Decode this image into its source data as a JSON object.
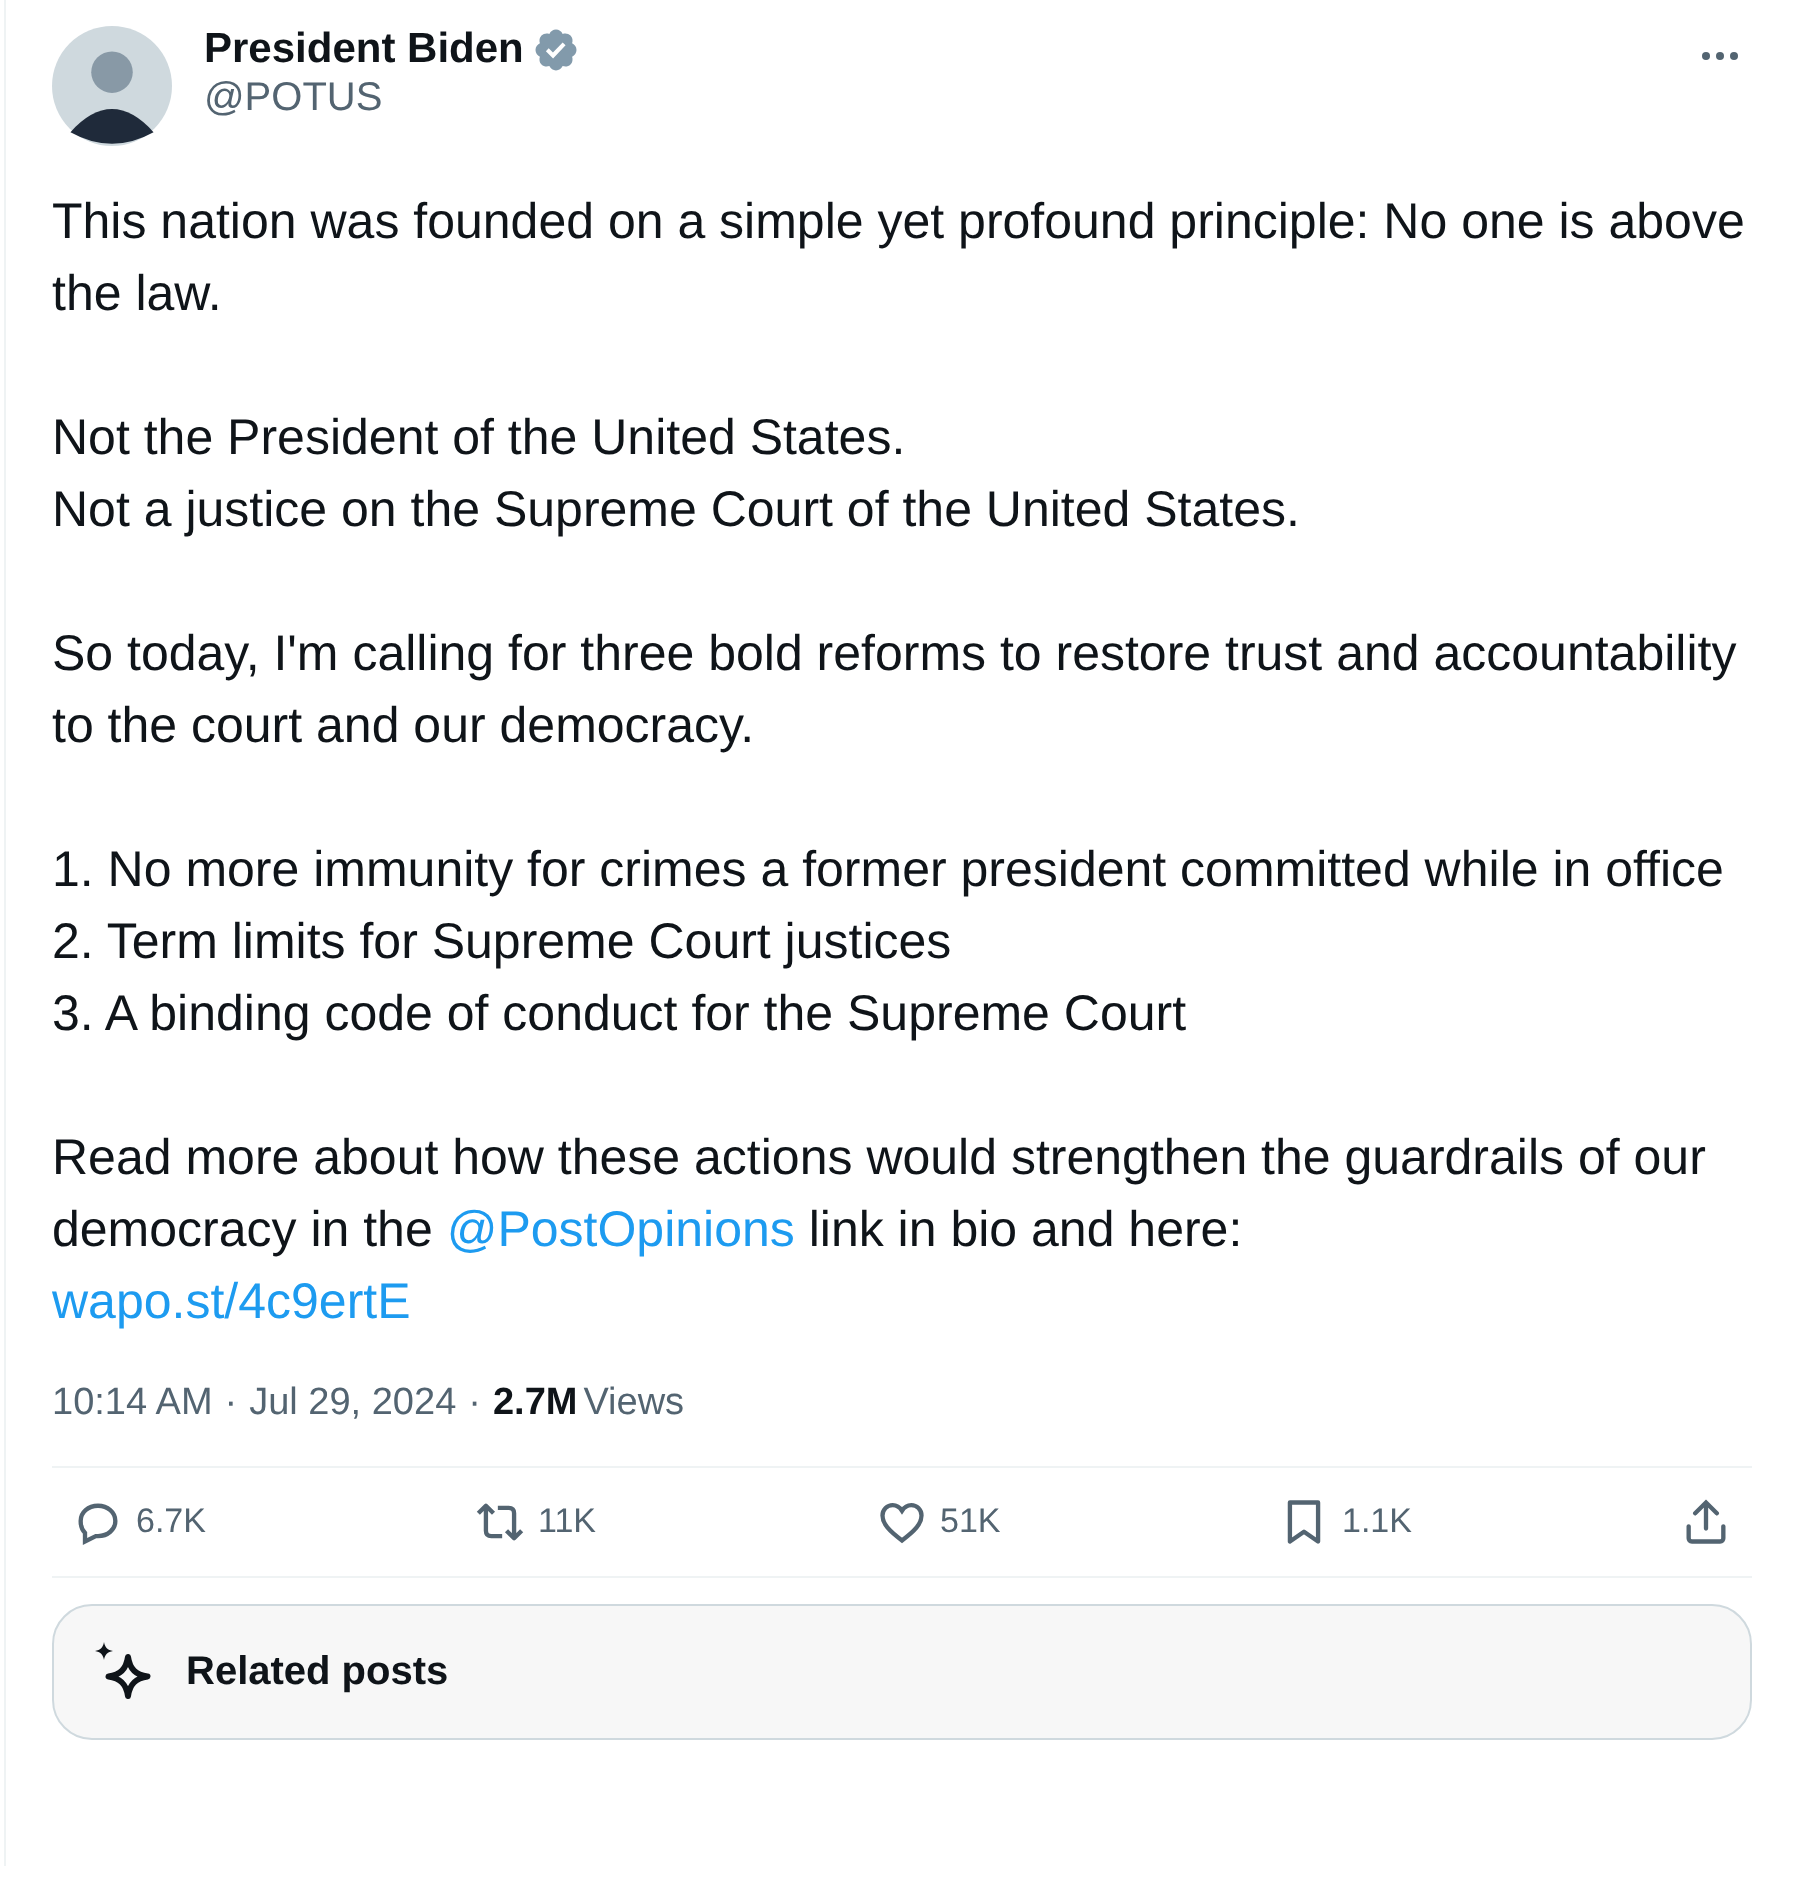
{
  "author": {
    "name": "President Biden",
    "verified": true,
    "handle": "@POTUS"
  },
  "paragraphs": [
    [
      {
        "text": "This nation was founded on a simple yet profound principle: No one is above the law."
      }
    ],
    [
      {
        "text": "Not the President of the United States.\nNot a justice on the Supreme Court of the United States."
      }
    ],
    [
      {
        "text": "So today, I'm calling for three bold reforms to restore trust and accountability to the court and our democracy."
      }
    ],
    [
      {
        "text": "1. No more immunity for crimes a former president committed while in office\n2. Term limits for Supreme Court justices\n3. A binding code of conduct for the Supreme Court"
      }
    ],
    [
      {
        "text": "Read more about how these actions would strengthen the guardrails of our democracy in the ",
        "kind": "plain"
      },
      {
        "text": "@PostOpinions",
        "kind": "mention"
      },
      {
        "text": " link in bio and here:\n",
        "kind": "plain"
      },
      {
        "text": "wapo.st/4c9ertE",
        "kind": "link"
      }
    ]
  ],
  "meta": {
    "time": "10:14 AM",
    "separator": "·",
    "date": "Jul 29, 2024",
    "views": "2.7M",
    "views_label": "Views"
  },
  "actions": [
    {
      "kind": "reply",
      "count": "6.7K"
    },
    {
      "kind": "repost",
      "count": "11K"
    },
    {
      "kind": "like",
      "count": "51K"
    },
    {
      "kind": "bookmark",
      "count": "1.1K"
    },
    {
      "kind": "share"
    }
  ],
  "related": {
    "label": "Related posts"
  }
}
